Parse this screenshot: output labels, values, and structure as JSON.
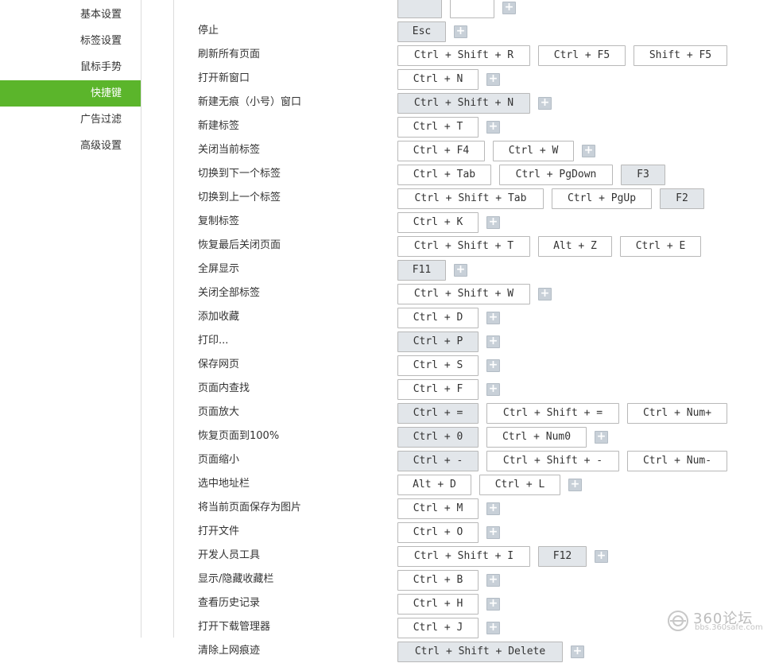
{
  "sidebar": {
    "items": [
      {
        "label": "基本设置",
        "active": false
      },
      {
        "label": "标签设置",
        "active": false
      },
      {
        "label": "鼠标手势",
        "active": false
      },
      {
        "label": "快捷键",
        "active": true
      },
      {
        "label": "广告过滤",
        "active": false
      },
      {
        "label": "高级设置",
        "active": false
      }
    ]
  },
  "shortcuts": [
    {
      "label": "",
      "keys": [
        {
          "text": "",
          "hl": true
        },
        {
          "text": "",
          "hl": false
        }
      ],
      "add": true
    },
    {
      "label": "停止",
      "keys": [
        {
          "text": "Esc",
          "hl": true
        }
      ],
      "add": true
    },
    {
      "label": "刷新所有页面",
      "keys": [
        {
          "text": "Ctrl + Shift + R",
          "hl": false
        },
        {
          "text": "Ctrl + F5",
          "hl": false
        },
        {
          "text": "Shift + F5",
          "hl": false
        }
      ],
      "add": false
    },
    {
      "label": "打开新窗口",
      "keys": [
        {
          "text": "Ctrl + N",
          "hl": false
        }
      ],
      "add": true
    },
    {
      "label": "新建无痕（小号）窗口",
      "keys": [
        {
          "text": "Ctrl + Shift + N",
          "hl": true
        }
      ],
      "add": true
    },
    {
      "label": "新建标签",
      "keys": [
        {
          "text": "Ctrl + T",
          "hl": false
        }
      ],
      "add": true
    },
    {
      "label": "关闭当前标签",
      "keys": [
        {
          "text": "Ctrl + F4",
          "hl": false
        },
        {
          "text": "Ctrl + W",
          "hl": false
        }
      ],
      "add": true
    },
    {
      "label": "切换到下一个标签",
      "keys": [
        {
          "text": "Ctrl + Tab",
          "hl": false
        },
        {
          "text": "Ctrl + PgDown",
          "hl": false
        },
        {
          "text": "F3",
          "hl": true
        }
      ],
      "add": false
    },
    {
      "label": "切换到上一个标签",
      "keys": [
        {
          "text": "Ctrl + Shift + Tab",
          "hl": false
        },
        {
          "text": "Ctrl + PgUp",
          "hl": false
        },
        {
          "text": "F2",
          "hl": true
        }
      ],
      "add": false
    },
    {
      "label": "复制标签",
      "keys": [
        {
          "text": "Ctrl + K",
          "hl": false
        }
      ],
      "add": true
    },
    {
      "label": "恢复最后关闭页面",
      "keys": [
        {
          "text": "Ctrl + Shift + T",
          "hl": false
        },
        {
          "text": "Alt + Z",
          "hl": false
        },
        {
          "text": "Ctrl + E",
          "hl": false
        }
      ],
      "add": false
    },
    {
      "label": "全屏显示",
      "keys": [
        {
          "text": "F11",
          "hl": true
        }
      ],
      "add": true
    },
    {
      "label": "关闭全部标签",
      "keys": [
        {
          "text": "Ctrl + Shift + W",
          "hl": false
        }
      ],
      "add": true
    },
    {
      "label": "添加收藏",
      "keys": [
        {
          "text": "Ctrl + D",
          "hl": false
        }
      ],
      "add": true
    },
    {
      "label": "打印...",
      "keys": [
        {
          "text": "Ctrl + P",
          "hl": true
        }
      ],
      "add": true
    },
    {
      "label": "保存网页",
      "keys": [
        {
          "text": "Ctrl + S",
          "hl": false
        }
      ],
      "add": true
    },
    {
      "label": "页面内查找",
      "keys": [
        {
          "text": "Ctrl + F",
          "hl": false
        }
      ],
      "add": true
    },
    {
      "label": "页面放大",
      "keys": [
        {
          "text": "Ctrl + =",
          "hl": true
        },
        {
          "text": "Ctrl + Shift + =",
          "hl": false
        },
        {
          "text": "Ctrl + Num+",
          "hl": false
        }
      ],
      "add": false
    },
    {
      "label": "恢复页面到100%",
      "keys": [
        {
          "text": "Ctrl + 0",
          "hl": true
        },
        {
          "text": "Ctrl + Num0",
          "hl": false
        }
      ],
      "add": true
    },
    {
      "label": "页面缩小",
      "keys": [
        {
          "text": "Ctrl + -",
          "hl": true
        },
        {
          "text": "Ctrl + Shift + -",
          "hl": false
        },
        {
          "text": "Ctrl + Num-",
          "hl": false
        }
      ],
      "add": false
    },
    {
      "label": "选中地址栏",
      "keys": [
        {
          "text": "Alt + D",
          "hl": false
        },
        {
          "text": "Ctrl + L",
          "hl": false
        }
      ],
      "add": true
    },
    {
      "label": "将当前页面保存为图片",
      "keys": [
        {
          "text": "Ctrl + M",
          "hl": false
        }
      ],
      "add": true
    },
    {
      "label": "打开文件",
      "keys": [
        {
          "text": "Ctrl + O",
          "hl": false
        }
      ],
      "add": true
    },
    {
      "label": "开发人员工具",
      "keys": [
        {
          "text": "Ctrl + Shift + I",
          "hl": false
        },
        {
          "text": "F12",
          "hl": true
        }
      ],
      "add": true
    },
    {
      "label": "显示/隐藏收藏栏",
      "keys": [
        {
          "text": "Ctrl + B",
          "hl": false
        }
      ],
      "add": true
    },
    {
      "label": "查看历史记录",
      "keys": [
        {
          "text": "Ctrl + H",
          "hl": false
        }
      ],
      "add": true
    },
    {
      "label": "打开下载管理器",
      "keys": [
        {
          "text": "Ctrl + J",
          "hl": false
        }
      ],
      "add": true
    },
    {
      "label": "清除上网痕迹",
      "keys": [
        {
          "text": "Ctrl + Shift + Delete",
          "hl": true
        }
      ],
      "add": true
    }
  ],
  "add_symbol": "+",
  "watermark": {
    "brand": "360论坛",
    "url": "bbs.360safe.com"
  },
  "colors": {
    "accent": "#5bb52b",
    "key_highlight": "#e2e6ea",
    "add_button": "#c8d0d8"
  }
}
